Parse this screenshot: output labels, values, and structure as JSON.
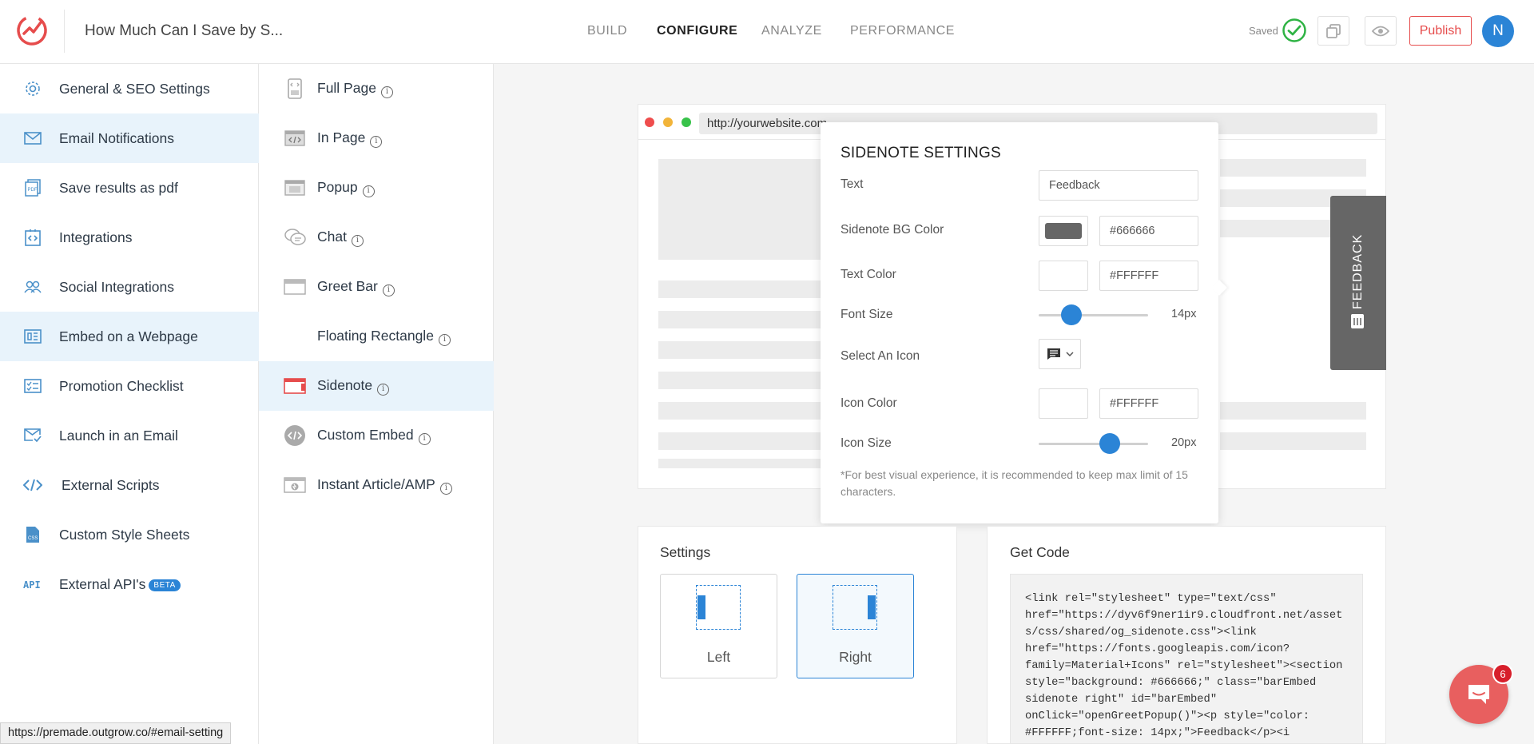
{
  "header": {
    "title": "How Much Can I Save by S...",
    "nav": [
      "BUILD",
      "CONFIGURE",
      "ANALYZE",
      "PERFORMANCE"
    ],
    "active_nav": "CONFIGURE",
    "saved_label": "Saved",
    "publish_label": "Publish",
    "avatar_initial": "N"
  },
  "sidebar": {
    "items": [
      {
        "label": "General & SEO Settings",
        "icon": "gear-icon"
      },
      {
        "label": "Email Notifications",
        "icon": "envelope-icon",
        "active": true
      },
      {
        "label": "Save results as pdf",
        "icon": "pdf-icon"
      },
      {
        "label": "Integrations",
        "icon": "integrations-icon"
      },
      {
        "label": "Social Integrations",
        "icon": "users-icon"
      },
      {
        "label": "Embed on a Webpage",
        "icon": "embed-icon",
        "active": true
      },
      {
        "label": "Promotion Checklist",
        "icon": "checklist-icon"
      },
      {
        "label": "Launch in an Email",
        "icon": "email-launch-icon"
      },
      {
        "label": "External Scripts",
        "icon": "code-icon"
      },
      {
        "label": "Custom Style Sheets",
        "icon": "css-icon"
      },
      {
        "label": "External API's",
        "icon": "api-icon",
        "badge": "BETA"
      }
    ]
  },
  "embed_types": {
    "items": [
      {
        "label": "Full Page",
        "icon": "full-page-icon"
      },
      {
        "label": "In Page",
        "icon": "in-page-icon"
      },
      {
        "label": "Popup",
        "icon": "popup-icon"
      },
      {
        "label": "Chat",
        "icon": "chat-icon"
      },
      {
        "label": "Greet Bar",
        "icon": "greet-bar-icon"
      },
      {
        "label": "Floating Rectangle",
        "icon": ""
      },
      {
        "label": "Sidenote",
        "icon": "sidenote-icon",
        "active": true
      },
      {
        "label": "Custom Embed",
        "icon": "custom-embed-icon"
      },
      {
        "label": "Instant Article/AMP",
        "icon": "amp-icon"
      }
    ]
  },
  "preview": {
    "url": "http://yourwebsite.com",
    "sidenote_text": "FEEDBACK",
    "sidenote_bg": "#666666"
  },
  "sidenote_settings": {
    "title": "SIDENOTE SETTINGS",
    "text_label": "Text",
    "text_value": "Feedback",
    "bg_color_label": "Sidenote BG Color",
    "bg_color_value": "#666666",
    "text_color_label": "Text Color",
    "text_color_value": "#FFFFFF",
    "font_size_label": "Font Size",
    "font_size_value": "14px",
    "font_size_fraction": 0.3,
    "select_icon_label": "Select An Icon",
    "icon_color_label": "Icon Color",
    "icon_color_value": "#FFFFFF",
    "icon_size_label": "Icon Size",
    "icon_size_value": "20px",
    "icon_size_fraction": 0.65,
    "note": "*For best visual experience, it is recommended to keep max limit of 15 characters."
  },
  "settings_card": {
    "title": "Settings",
    "left_label": "Left",
    "right_label": "Right",
    "selected": "Right"
  },
  "code_card": {
    "title": "Get Code",
    "code": "<link rel=\"stylesheet\" type=\"text/css\"\nhref=\"https://dyv6f9ner1ir9.cloudfront.net/asset\ns/css/shared/og_sidenote.css\"><link\nhref=\"https://fonts.googleapis.com/icon?\nfamily=Material+Icons\" rel=\"stylesheet\"><section\nstyle=\"background: #666666;\" class=\"barEmbed\nsidenote right\" id=\"barEmbed\"\nonClick=\"openGreetPopup()\"><p style=\"color:\n#FFFFFF;font-size: 14px;\">Feedback</p><i"
  },
  "chat_widget": {
    "badge_count": "6"
  },
  "status_bar": {
    "url": "https://premade.outgrow.co/#email-setting"
  },
  "colors": {
    "accent": "#2b84d6",
    "brand": "#e64c4c",
    "selected_bg": "#e8f3fb"
  }
}
